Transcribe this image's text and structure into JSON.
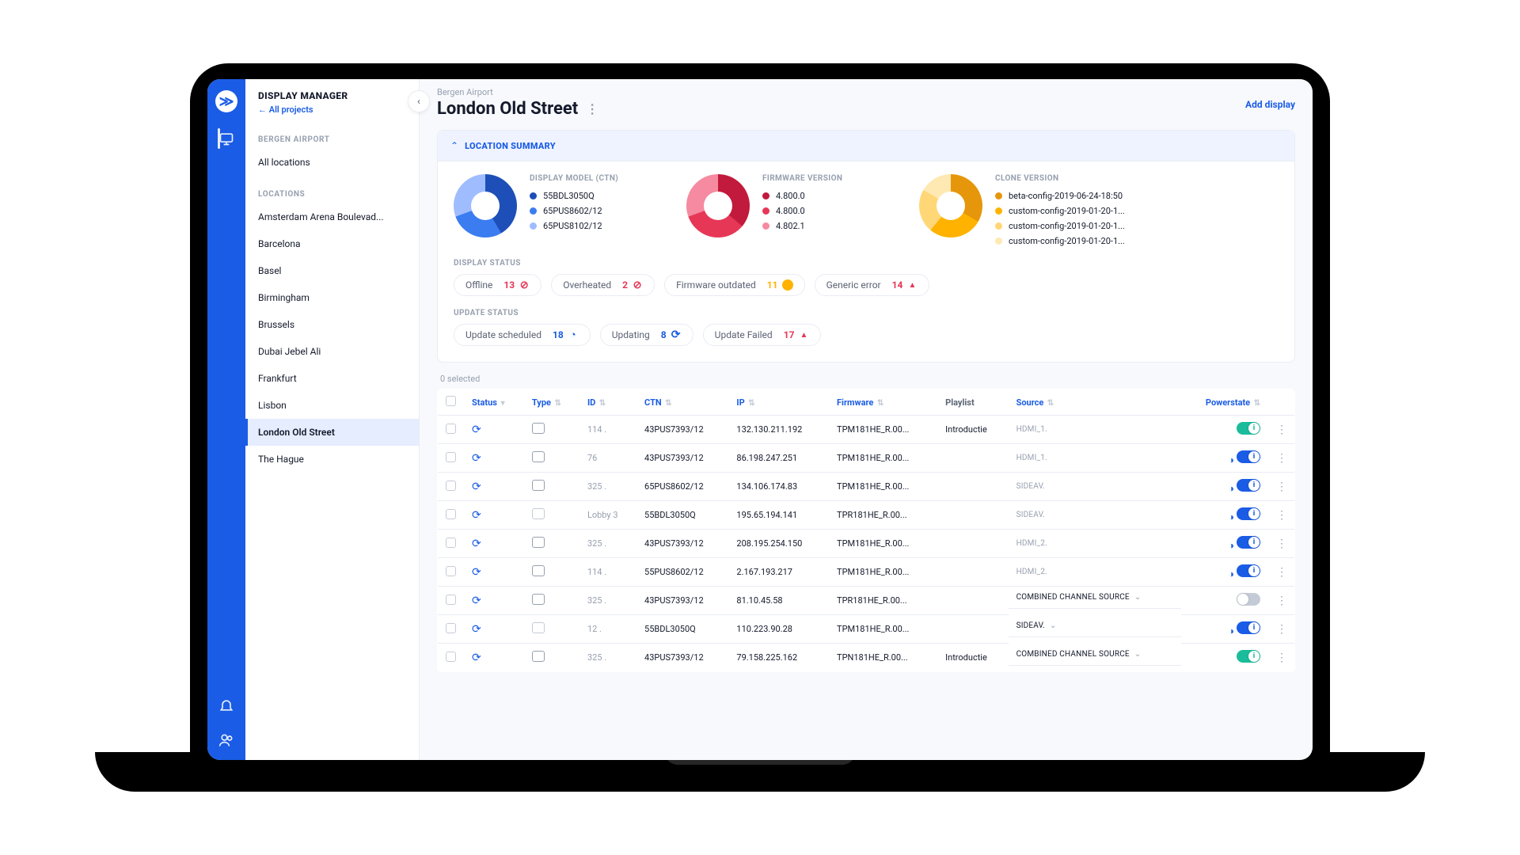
{
  "rail": {
    "logo": "≫",
    "nav": [
      {
        "name": "displays-nav-icon",
        "active": true
      },
      {
        "name": "notifications-nav-icon",
        "active": false
      },
      {
        "name": "users-nav-icon",
        "active": false
      }
    ]
  },
  "sidebar": {
    "title": "DISPLAY MANAGER",
    "back_label": "← All projects",
    "section_a_label": "BERGEN AIRPORT",
    "all_locations_label": "All locations",
    "section_b_label": "LOCATIONS",
    "active_id": "London Old Street",
    "locations": [
      "Amsterdam Arena Boulevad...",
      "Barcelona",
      "Basel",
      "Birmingham",
      "Brussels",
      "Dubai Jebel Ali",
      "Frankfurt",
      "Lisbon",
      "London Old Street",
      "The Hague"
    ]
  },
  "header": {
    "breadcrumb": "Bergen Airport",
    "title": "London Old Street",
    "add_label": "Add display"
  },
  "summary": {
    "card_title": "LOCATION SUMMARY",
    "donuts": {
      "model": {
        "heading": "DISPLAY MODEL (CTN)",
        "variant": "blue",
        "items": [
          {
            "color": "#1e4fb8",
            "label": "55BDL3050Q"
          },
          {
            "color": "#3b7cf0",
            "label": "65PUS8602/12"
          },
          {
            "color": "#9fbcff",
            "label": "65PUS8102/12"
          }
        ]
      },
      "firmware": {
        "heading": "FIRMWARE VERSION",
        "variant": "red",
        "items": [
          {
            "color": "#c11a3c",
            "label": "4.800.0"
          },
          {
            "color": "#e63757",
            "label": "4.800.0"
          },
          {
            "color": "#f58aa0",
            "label": "4.802.1"
          }
        ]
      },
      "clone": {
        "heading": "CLONE VERSION",
        "variant": "amber",
        "items": [
          {
            "color": "#e6960a",
            "label": "beta-config-2019-06-24-18:50"
          },
          {
            "color": "#ffb300",
            "label": "custom-config-2019-01-20-1..."
          },
          {
            "color": "#ffd777",
            "label": "custom-config-2019-01-20-1..."
          },
          {
            "color": "#ffe9b3",
            "label": "custom-config-2019-01-20-1..."
          }
        ]
      }
    },
    "display_status_label": "DISPLAY STATUS",
    "display_status": [
      {
        "label": "Offline",
        "count": "13",
        "variant": "red",
        "icon": "no"
      },
      {
        "label": "Overheated",
        "count": "2",
        "variant": "red",
        "icon": "no"
      },
      {
        "label": "Firmware outdated",
        "count": "11",
        "variant": "amber",
        "icon": "dot"
      },
      {
        "label": "Generic error",
        "count": "14",
        "variant": "red",
        "icon": "warn"
      }
    ],
    "update_status_label": "UPDATE STATUS",
    "update_status": [
      {
        "label": "Update scheduled",
        "count": "18",
        "variant": "blue",
        "icon": "clock"
      },
      {
        "label": "Updating",
        "count": "8",
        "variant": "blue",
        "icon": "sync"
      },
      {
        "label": "Update Failed",
        "count": "17",
        "variant": "red",
        "icon": "warn"
      }
    ]
  },
  "table": {
    "selected_label": "0 selected",
    "columns": {
      "status": "Status",
      "type": "Type",
      "id": "ID",
      "ctn": "CTN",
      "ip": "IP",
      "fw": "Firmware",
      "playlist": "Playlist",
      "source": "Source",
      "power": "Powerstate"
    },
    "rows": [
      {
        "id": "114 .",
        "ctn": "43PUS7393/12",
        "ip": "132.130.211.192",
        "fw": "TPM181HE_R.00...",
        "playlist": "Introductie",
        "source": "HDMI_1.",
        "srcMuted": true,
        "sched": false,
        "power": "green"
      },
      {
        "id": "76",
        "ctn": "43PUS7393/12",
        "ip": "86.198.247.251",
        "fw": "TPM181HE_R.00...",
        "playlist": "",
        "source": "HDMI_1.",
        "srcMuted": true,
        "sched": true,
        "power": "on"
      },
      {
        "id": "325 .",
        "ctn": "65PUS8602/12",
        "ip": "134.106.174.83",
        "fw": "TPM181HE_R.00...",
        "playlist": "",
        "source": "SIDEAV.",
        "srcMuted": true,
        "sched": true,
        "power": "on"
      },
      {
        "id": "Lobby 3",
        "ctn": "55BDL3050Q",
        "ip": "195.65.194.141",
        "fw": "TPR181HE_R.00...",
        "playlist": "",
        "source": "SIDEAV.",
        "srcMuted": true,
        "sched": true,
        "power": "on",
        "typeAlt": true
      },
      {
        "id": "325 .",
        "ctn": "43PUS7393/12",
        "ip": "208.195.254.150",
        "fw": "TPM181HE_R.00...",
        "playlist": "",
        "source": "HDMI_2.",
        "srcMuted": true,
        "sched": true,
        "power": "on"
      },
      {
        "id": "114 .",
        "ctn": "55PUS8602/12",
        "ip": "2.167.193.217",
        "fw": "TPM181HE_R.00...",
        "playlist": "",
        "source": "HDMI_2.",
        "srcMuted": true,
        "sched": true,
        "power": "on"
      },
      {
        "id": "325 .",
        "ctn": "43PUS7393/12",
        "ip": "81.10.45.58",
        "fw": "TPR181HE_R.00...",
        "playlist": "",
        "source": "COMBINED CHANNEL SOURCE",
        "srcMuted": false,
        "chev": true,
        "sched": false,
        "power": "off"
      },
      {
        "id": "12 .",
        "ctn": "55BDL3050Q",
        "ip": "110.223.90.28",
        "fw": "TPM181HE_R.00...",
        "playlist": "",
        "source": "SIDEAV.",
        "srcMuted": false,
        "chev": true,
        "sched": true,
        "power": "on",
        "typeAlt": true
      },
      {
        "id": "325 .",
        "ctn": "43PUS7393/12",
        "ip": "79.158.225.162",
        "fw": "TPN181HE_R.00...",
        "playlist": "Introductie",
        "source": "COMBINED CHANNEL SOURCE",
        "srcMuted": false,
        "chev": true,
        "sched": false,
        "power": "green"
      }
    ]
  },
  "chart_data": [
    {
      "type": "pie",
      "title": "DISPLAY MODEL (CTN)",
      "slices": [
        {
          "label": "55BDL3050Q",
          "value": 42
        },
        {
          "label": "65PUS8602/12",
          "value": 28
        },
        {
          "label": "65PUS8102/12",
          "value": 30
        }
      ]
    },
    {
      "type": "pie",
      "title": "FIRMWARE VERSION",
      "slices": [
        {
          "label": "4.800.0",
          "value": 36
        },
        {
          "label": "4.800.0",
          "value": 34
        },
        {
          "label": "4.802.1",
          "value": 30
        }
      ]
    },
    {
      "type": "pie",
      "title": "CLONE VERSION",
      "slices": [
        {
          "label": "beta-config-2019-06-24-18:50",
          "value": 30
        },
        {
          "label": "custom-config-2019-01-20-1...",
          "value": 28
        },
        {
          "label": "custom-config-2019-01-20-1...",
          "value": 22
        },
        {
          "label": "custom-config-2019-01-20-1...",
          "value": 20
        }
      ]
    }
  ]
}
